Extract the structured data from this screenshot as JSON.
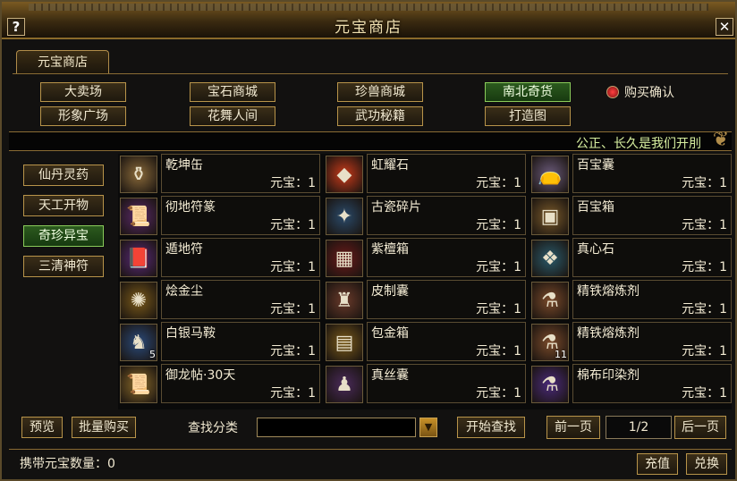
{
  "window": {
    "title": "元宝商店",
    "help_label": "?",
    "close_label": "✕"
  },
  "main_tab": "元宝商店",
  "categories": {
    "row1": [
      "大卖场",
      "宝石商城",
      "珍兽商城",
      "南北奇货"
    ],
    "row2": [
      "形象广场",
      "花舞人间",
      "武功秘籍",
      "打造图"
    ],
    "selected": "南北奇货"
  },
  "buy_confirm_label": "购买确认",
  "marquee": "公正、长久是我们开刖",
  "sidebar": {
    "items": [
      "仙丹灵药",
      "天工开物",
      "奇珍异宝",
      "三清神符"
    ],
    "selected": "奇珍异宝"
  },
  "items": [
    {
      "name": "乾坤缶",
      "price": "元宝：1",
      "icon": "jar-icon",
      "color": "#8a6a3a",
      "glyph": "⚱"
    },
    {
      "name": "虹耀石",
      "price": "元宝：1",
      "icon": "gem-icon",
      "color": "#c83a1a",
      "glyph": "◆"
    },
    {
      "name": "百宝囊",
      "price": "元宝：1",
      "icon": "pouch-icon",
      "color": "#6a5a7a",
      "glyph": "👝"
    },
    {
      "name": "彻地符篆",
      "price": "元宝：1",
      "icon": "talisman-icon",
      "color": "#5a2a6a",
      "glyph": "📜"
    },
    {
      "name": "古瓷碎片",
      "price": "元宝：1",
      "icon": "shard-icon",
      "color": "#2a4a6a",
      "glyph": "✦"
    },
    {
      "name": "百宝箱",
      "price": "元宝：1",
      "icon": "chest-icon",
      "color": "#7a5a2a",
      "glyph": "▣"
    },
    {
      "name": "遁地符",
      "price": "元宝：1",
      "icon": "book-icon",
      "color": "#5a2a7a",
      "glyph": "📕"
    },
    {
      "name": "紫檀箱",
      "price": "元宝：1",
      "icon": "box-icon",
      "color": "#6a1a1a",
      "glyph": "▦"
    },
    {
      "name": "真心石",
      "price": "元宝：1",
      "icon": "crystal-icon",
      "color": "#2a5a6a",
      "glyph": "❖"
    },
    {
      "name": "烩金尘",
      "price": "元宝：1",
      "icon": "dust-icon",
      "color": "#7a5a1a",
      "glyph": "✺"
    },
    {
      "name": "皮制囊",
      "price": "元宝：1",
      "icon": "bag-icon",
      "color": "#6a3a2a",
      "glyph": "♜"
    },
    {
      "name": "精铁熔炼剂",
      "price": "元宝：1",
      "icon": "potion-icon",
      "color": "#7a4a2a",
      "glyph": "⚗"
    },
    {
      "name": "白银马鞍",
      "price": "元宝：1",
      "icon": "saddle-icon",
      "color": "#2a4a7a",
      "glyph": "♞",
      "stack": "5"
    },
    {
      "name": "包金箱",
      "price": "元宝：1",
      "icon": "gold-chest-icon",
      "color": "#7a5a1a",
      "glyph": "▤"
    },
    {
      "name": "精铁熔炼剂",
      "price": "元宝：1",
      "icon": "potion-icon",
      "color": "#7a4a2a",
      "glyph": "⚗",
      "stack": "11"
    },
    {
      "name": "御龙帖·30天",
      "price": "元宝：1",
      "icon": "scroll-icon",
      "color": "#8a6a2a",
      "glyph": "📜"
    },
    {
      "name": "真丝囊",
      "price": "元宝：1",
      "icon": "silk-bag-icon",
      "color": "#4a2a5a",
      "glyph": "♟"
    },
    {
      "name": "棉布印染剂",
      "price": "元宝：1",
      "icon": "dye-icon",
      "color": "#4a2a7a",
      "glyph": "⚗"
    }
  ],
  "bottom": {
    "preview": "预览",
    "bulk_buy": "批量购买",
    "search_label": "查找分类",
    "search_value": "",
    "start_search": "开始查找",
    "prev_page": "前一页",
    "page": "1/2",
    "next_page": "后一页",
    "ingot_count": "携带元宝数量：0",
    "recharge": "充值",
    "exchange": "兑换"
  }
}
